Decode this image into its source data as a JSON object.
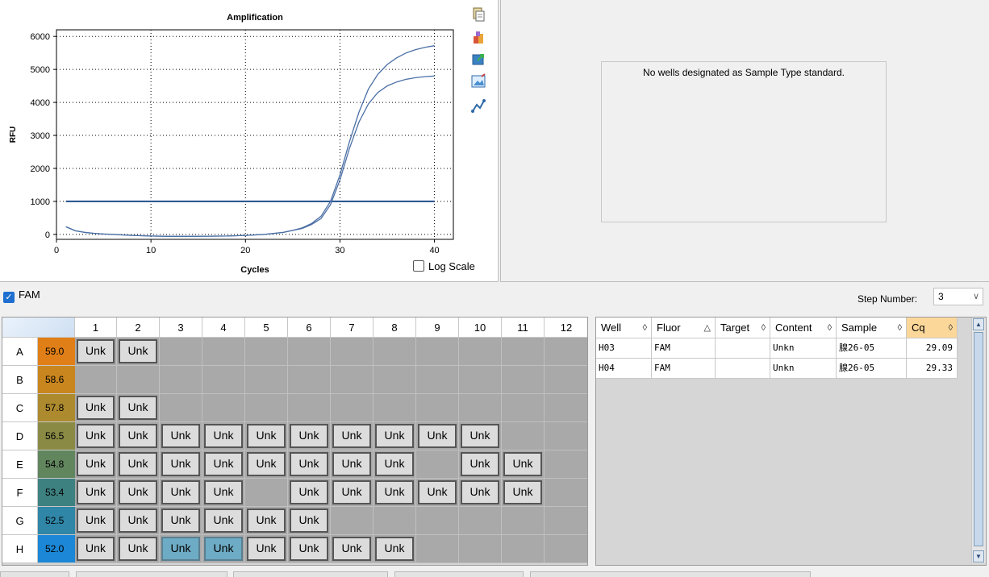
{
  "chart_data": {
    "type": "line",
    "title": "Amplification",
    "xlabel": "Cycles",
    "ylabel": "RFU",
    "xlim": [
      0,
      42
    ],
    "ylim": [
      -150,
      6200
    ],
    "xticks": [
      0,
      10,
      20,
      30,
      40
    ],
    "yticks": [
      0,
      1000,
      2000,
      3000,
      4000,
      5000,
      6000
    ],
    "grid": true,
    "threshold": 1000,
    "series": [
      {
        "x": [
          1,
          2,
          3,
          4,
          5,
          6,
          8,
          10,
          12,
          14,
          16,
          18,
          20,
          22,
          24,
          25,
          26,
          27,
          28,
          29,
          30,
          31,
          32,
          33,
          34,
          35,
          36,
          37,
          38,
          39,
          40
        ],
        "values": [
          230,
          110,
          60,
          30,
          10,
          0,
          -30,
          -50,
          -60,
          -60,
          -55,
          -50,
          -30,
          0,
          60,
          120,
          200,
          330,
          550,
          1000,
          1800,
          2800,
          3700,
          4400,
          4850,
          5150,
          5350,
          5500,
          5600,
          5670,
          5720
        ]
      },
      {
        "x": [
          1,
          2,
          3,
          4,
          5,
          6,
          8,
          10,
          12,
          14,
          16,
          18,
          20,
          22,
          24,
          25,
          26,
          27,
          28,
          29,
          30,
          31,
          32,
          33,
          34,
          35,
          36,
          37,
          38,
          39,
          40
        ],
        "values": [
          230,
          110,
          60,
          30,
          10,
          0,
          -30,
          -50,
          -60,
          -60,
          -55,
          -50,
          -30,
          0,
          60,
          120,
          180,
          300,
          480,
          900,
          1650,
          2600,
          3400,
          3950,
          4300,
          4500,
          4620,
          4700,
          4750,
          4780,
          4800
        ]
      }
    ]
  },
  "chart_panel": {
    "log_scale_label": "Log Scale"
  },
  "standard_panel": {
    "message": "No wells designated as Sample Type standard."
  },
  "fluor_bar": {
    "fam_label": "FAM",
    "step_label": "Step Number:",
    "step_value": "3"
  },
  "plate": {
    "columns": [
      "1",
      "2",
      "3",
      "4",
      "5",
      "6",
      "7",
      "8",
      "9",
      "10",
      "11",
      "12"
    ],
    "rows": [
      {
        "label": "A",
        "temp": "59.0",
        "color": "#e07f17",
        "wells": [
          "Unk",
          "Unk",
          "",
          "",
          "",
          "",
          "",
          "",
          "",
          "",
          "",
          ""
        ]
      },
      {
        "label": "B",
        "temp": "58.6",
        "color": "#c9861e",
        "wells": [
          "",
          "",
          "",
          "",
          "",
          "",
          "",
          "",
          "",
          "",
          "",
          ""
        ]
      },
      {
        "label": "C",
        "temp": "57.8",
        "color": "#ae8a2f",
        "wells": [
          "Unk",
          "Unk",
          "",
          "",
          "",
          "",
          "",
          "",
          "",
          "",
          "",
          ""
        ]
      },
      {
        "label": "D",
        "temp": "56.5",
        "color": "#8a8a45",
        "wells": [
          "Unk",
          "Unk",
          "Unk",
          "Unk",
          "Unk",
          "Unk",
          "Unk",
          "Unk",
          "Unk",
          "Unk",
          "",
          ""
        ]
      },
      {
        "label": "E",
        "temp": "54.8",
        "color": "#61865e",
        "wells": [
          "Unk",
          "Unk",
          "Unk",
          "Unk",
          "Unk",
          "Unk",
          "Unk",
          "Unk",
          "",
          "Unk",
          "Unk",
          ""
        ]
      },
      {
        "label": "F",
        "temp": "53.4",
        "color": "#3e8181",
        "wells": [
          "Unk",
          "Unk",
          "Unk",
          "Unk",
          "",
          "Unk",
          "Unk",
          "Unk",
          "Unk",
          "Unk",
          "Unk",
          ""
        ]
      },
      {
        "label": "G",
        "temp": "52.5",
        "color": "#2f86a7",
        "wells": [
          "Unk",
          "Unk",
          "Unk",
          "Unk",
          "Unk",
          "Unk",
          "",
          "",
          "",
          "",
          "",
          ""
        ]
      },
      {
        "label": "H",
        "temp": "52.0",
        "color": "#1b87d6",
        "wells": [
          "Unk",
          "Unk",
          "Unk",
          "Unk",
          "Unk",
          "Unk",
          "Unk",
          "Unk",
          "",
          "",
          "",
          ""
        ],
        "selected": [
          2,
          3
        ]
      }
    ]
  },
  "results": {
    "headers": [
      {
        "label": "Well",
        "sort": "◊"
      },
      {
        "label": "Fluor",
        "sort": "△"
      },
      {
        "label": "Target",
        "sort": "◊"
      },
      {
        "label": "Content",
        "sort": "◊"
      },
      {
        "label": "Sample",
        "sort": "◊"
      },
      {
        "label": "Cq",
        "sort": "◊"
      }
    ],
    "rows": [
      [
        "H03",
        "FAM",
        "",
        "Unkn",
        "腺26-05",
        "29.09"
      ],
      [
        "H04",
        "FAM",
        "",
        "Unkn",
        "腺26-05",
        "29.33"
      ]
    ]
  },
  "toolbar_icons": [
    "copy-icon",
    "export-icon",
    "chart-export-icon",
    "image-icon",
    "chart-settings-icon"
  ],
  "colors": {
    "curve": "#4a6fa5",
    "threshold": "#1f4e8c",
    "selected_well": "#6eabc4",
    "sort_active": "#fbd79a"
  }
}
